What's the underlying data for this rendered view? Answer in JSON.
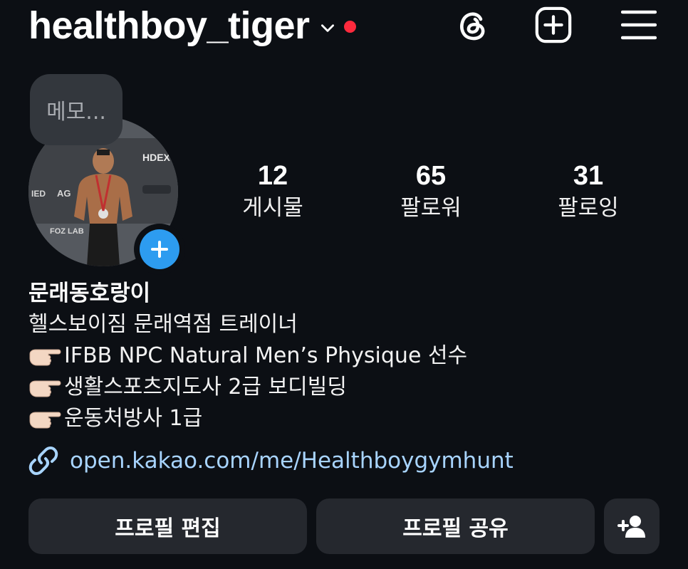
{
  "header": {
    "username": "healthboy_tiger",
    "icons": [
      "chevron-down-icon",
      "notification-dot",
      "threads-icon",
      "new-post-icon",
      "menu-icon"
    ],
    "accent_red": "#ff2a3d"
  },
  "note": {
    "text": "메모..."
  },
  "avatar": {
    "story_add_color": "#2d9cf0"
  },
  "stats": [
    {
      "value": "12",
      "label": "게시물"
    },
    {
      "value": "65",
      "label": "팔로워"
    },
    {
      "value": "31",
      "label": "팔로잉"
    }
  ],
  "bio": {
    "display_name": "문래동호랑이",
    "lines": [
      "헬스보이짐 문래역점 트레이너",
      "IFBB NPC Natural Men’s Physique 선수",
      "생활스포츠지도사 2급 보디빌딩",
      "운동처방사 1급"
    ],
    "link": "open.kakao.com/me/Healthboygymhunt",
    "link_color": "#a8d4ff"
  },
  "buttons": {
    "edit": "프로필 편집",
    "share": "프로필 공유"
  }
}
